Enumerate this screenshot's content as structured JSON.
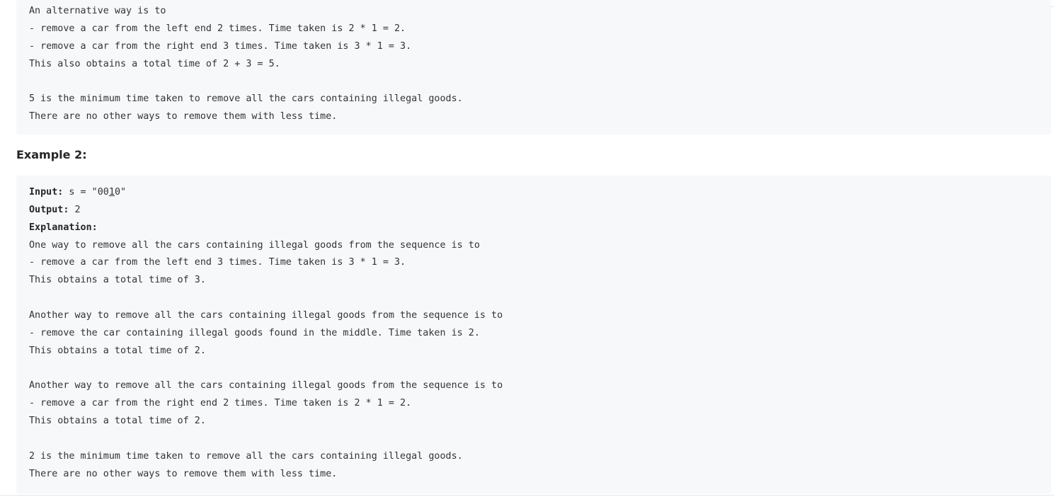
{
  "example1_tail": {
    "lines": [
      "An alternative way is to",
      "- remove a car from the left end 2 times. Time taken is 2 * 1 = 2.",
      "- remove a car from the right end 3 times. Time taken is 3 * 1 = 3.",
      "This also obtains a total time of 2 + 3 = 5.",
      "",
      "5 is the minimum time taken to remove all the cars containing illegal goods.",
      "There are no other ways to remove them with less time."
    ]
  },
  "example2": {
    "heading": "Example 2:",
    "input_label": "Input:",
    "input_prefix": " s = \"00",
    "input_highlight": "1",
    "input_suffix": "0\"",
    "output_label": "Output:",
    "output_value": " 2",
    "explanation_label": "Explanation:",
    "lines": [
      "One way to remove all the cars containing illegal goods from the sequence is to",
      "- remove a car from the left end 3 times. Time taken is 3 * 1 = 3.",
      "This obtains a total time of 3.",
      "",
      "Another way to remove all the cars containing illegal goods from the sequence is to",
      "- remove the car containing illegal goods found in the middle. Time taken is 2.",
      "This obtains a total time of 2.",
      "",
      "Another way to remove all the cars containing illegal goods from the sequence is to",
      "- remove a car from the right end 2 times. Time taken is 2 * 1 = 2.",
      "This obtains a total time of 2.",
      "",
      "2 is the minimum time taken to remove all the cars containing illegal goods.",
      "There are no other ways to remove them with less time."
    ]
  }
}
